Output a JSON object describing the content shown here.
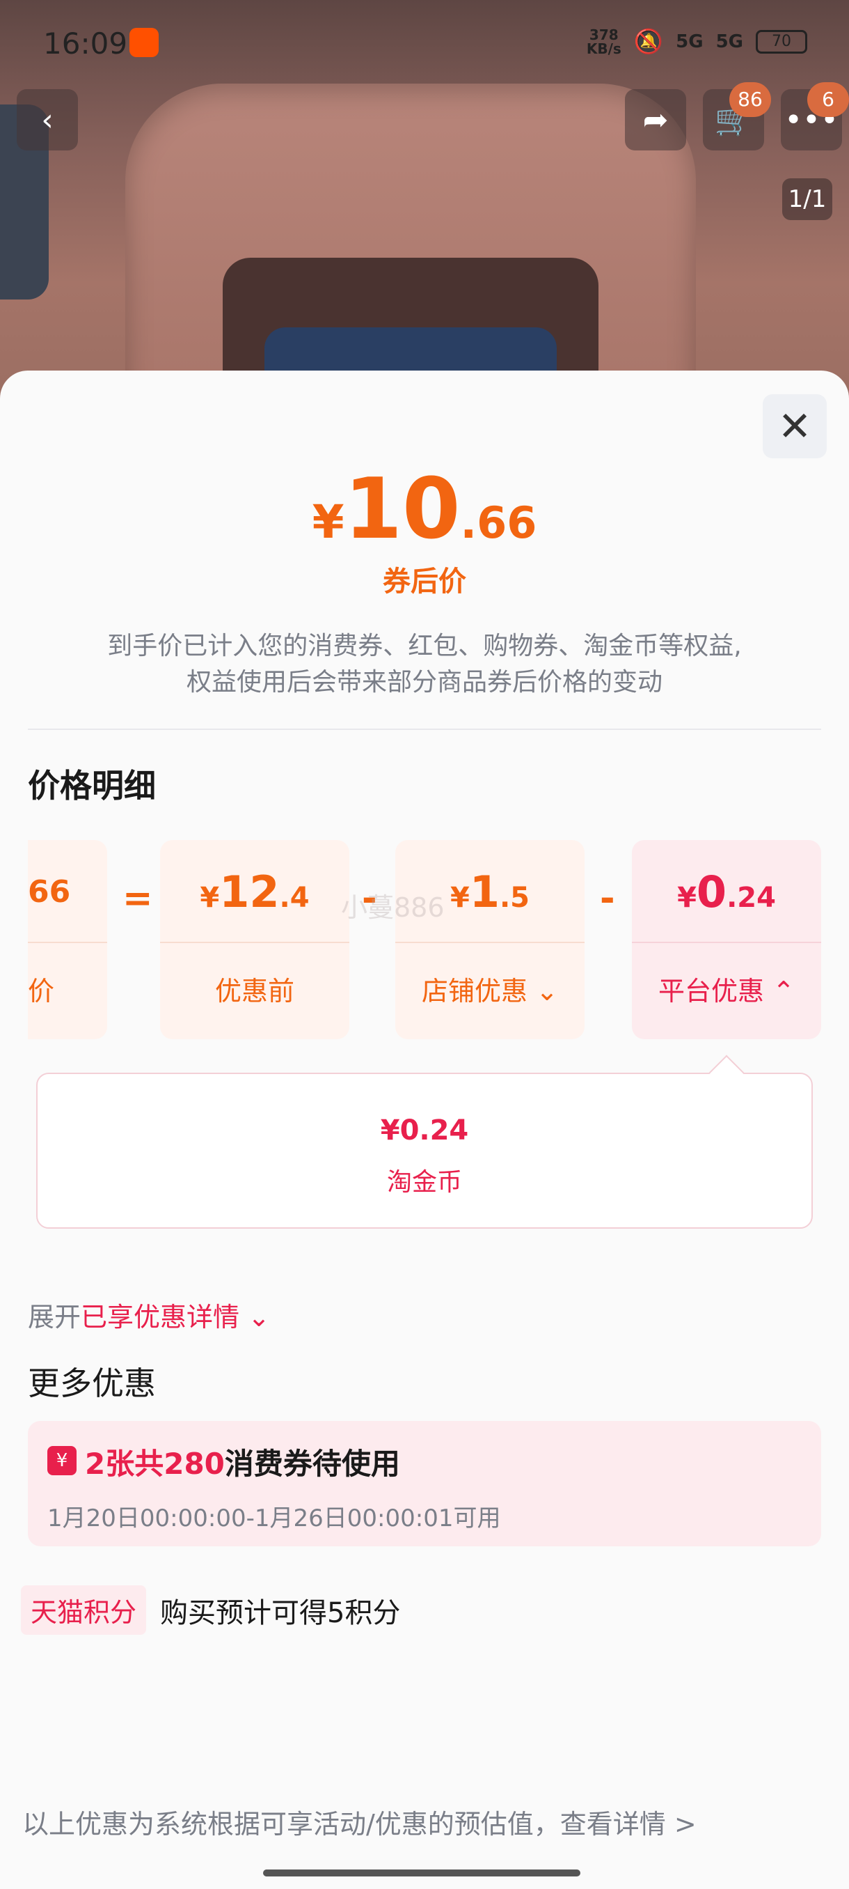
{
  "status_bar": {
    "time": "16:09",
    "net_speed": "378\nKB/s",
    "signal_1": "5G",
    "signal_2": "5G",
    "battery": "70"
  },
  "top_bar": {
    "cart_badge": "86",
    "more_badge": "6",
    "image_counter": "1/1"
  },
  "sheet": {
    "price": {
      "currency": "¥",
      "integer": "10",
      "decimal": ".66",
      "label": "券后价"
    },
    "note_line1": "到手价已计入您的消费券、红包、购物券、淘金币等权益,",
    "note_line2": "权益使用后会带来部分商品券后价格的变动",
    "detail_title": "价格明细",
    "breakdown": {
      "partial": {
        "value": "66",
        "label": "价"
      },
      "eq": "=",
      "minus": "-",
      "before": {
        "currency": "¥",
        "integer": "12",
        "decimal": ".4",
        "label": "优惠前"
      },
      "store": {
        "currency": "¥",
        "integer": "1",
        "decimal": ".5",
        "label": "店铺优惠",
        "chevron": "⌄"
      },
      "platform": {
        "currency": "¥",
        "integer": "0",
        "decimal": ".24",
        "label": "平台优惠",
        "chevron": "⌃"
      }
    },
    "watermark": "小蔓886",
    "popover": {
      "value": "¥0.24",
      "label": "淘金币"
    },
    "expand": {
      "prefix": "展开",
      "highlight": "已享优惠详情",
      "chevron": "⌄"
    },
    "more_title": "更多优惠",
    "coupon": {
      "icon": "¥",
      "highlight": "2张共280",
      "text": "消费券待使用",
      "dates": "1月20日00:00:00-1月26日00:00:01可用"
    },
    "points": {
      "tag": "天猫积分",
      "text": "购买预计可得5积分"
    },
    "footer": "以上优惠为系统根据可享活动/优惠的预估值，查看详情 >"
  },
  "colors": {
    "accent_orange": "#f26511",
    "accent_red": "#e8204c",
    "muted": "#7a7e88"
  }
}
